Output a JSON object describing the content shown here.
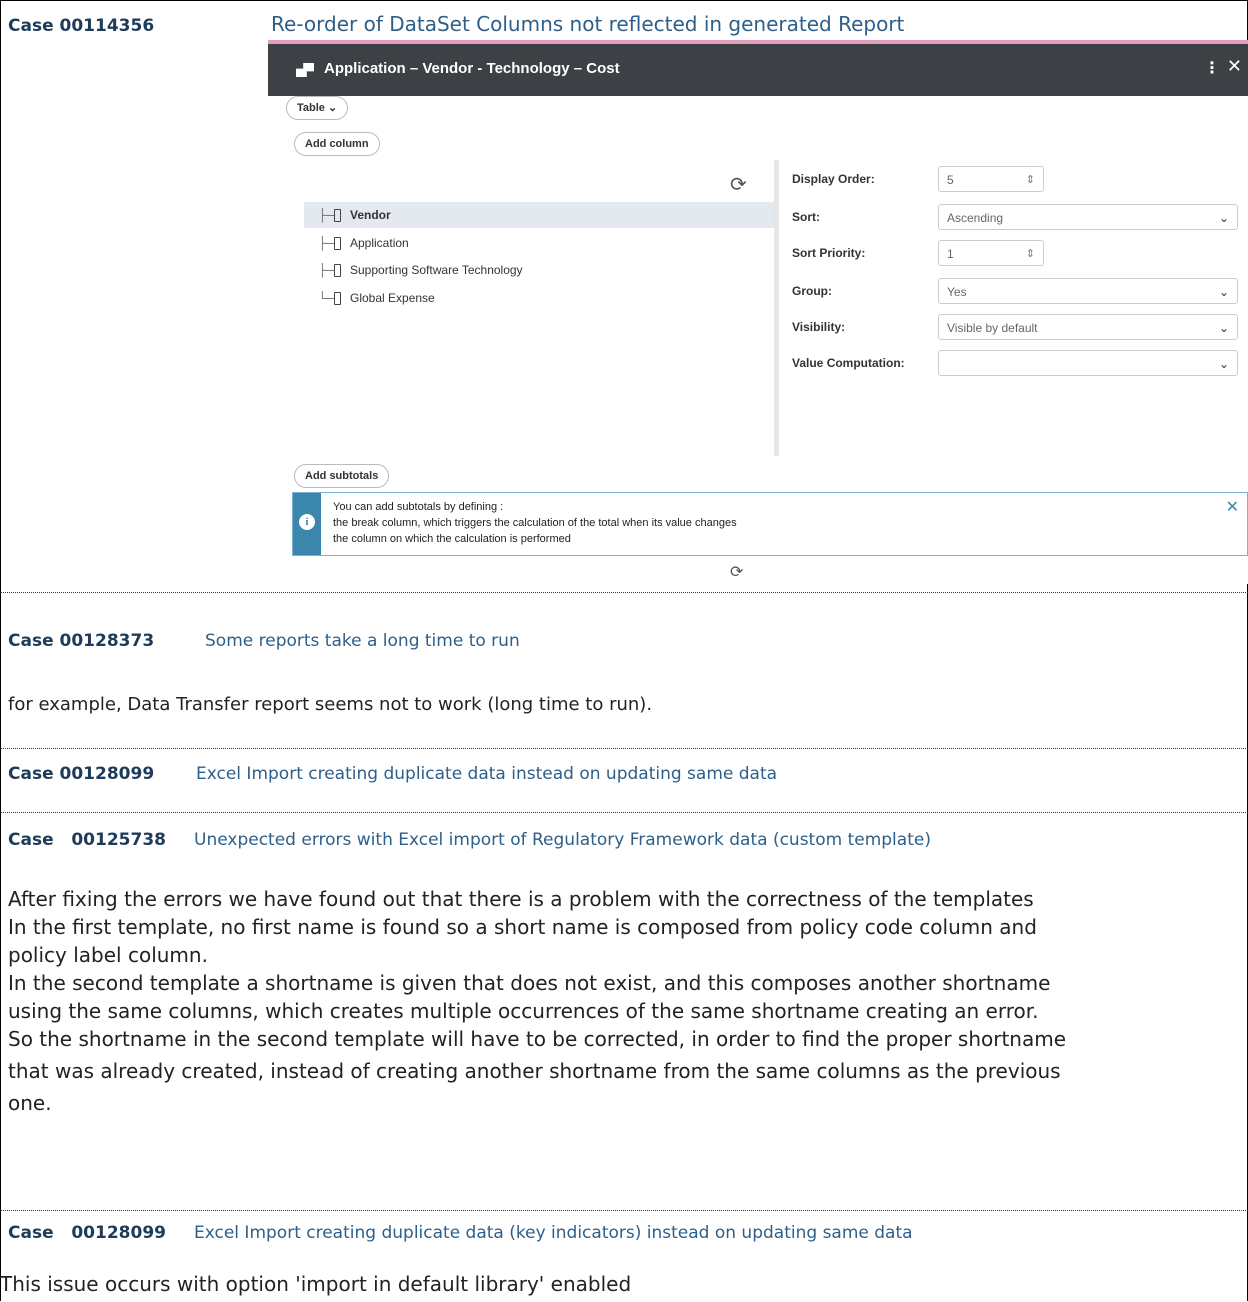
{
  "case1": {
    "id": "Case 00114356",
    "title": "Re-order of DataSet Columns not reflected in generated Report",
    "screenshot": {
      "window_title": "Application – Vendor - Technology – Cost",
      "menu_glyph": "⋮",
      "close_glyph": "✕",
      "view_dropdown": "Table",
      "add_column": "Add column",
      "add_subtotals": "Add subtotals",
      "tree_items": [
        "Vendor",
        "Application",
        "Supporting Software Technology",
        "Global Expense"
      ],
      "selected_item": "Vendor",
      "properties": {
        "display_order_label": "Display Order:",
        "display_order_value": "5",
        "sort_label": "Sort:",
        "sort_value": "Ascending",
        "sort_priority_label": "Sort Priority:",
        "sort_priority_value": "1",
        "group_label": "Group:",
        "group_value": "Yes",
        "visibility_label": "Visibility:",
        "visibility_value": "Visible by default",
        "value_computation_label": "Value Computation:",
        "value_computation_value": ""
      },
      "info": {
        "line1": "You can add subtotals by defining :",
        "line2": "the break column, which triggers the calculation of the total when its value changes",
        "line3": "the column on which the calculation is performed"
      },
      "colors": {
        "title_bar": "#3d4146",
        "info_accent": "#3a86ad",
        "selection": "#e4e8ef"
      }
    }
  },
  "case2": {
    "id": "Case 00128373",
    "title": "Some reports take a long time to run",
    "body": "for example, Data Transfer report seems not to work (long time to run)."
  },
  "case3": {
    "id": "Case 00128099",
    "title": "Excel Import creating duplicate data instead on updating same data"
  },
  "case4": {
    "id": "Case   00125738",
    "title": "Unexpected errors with Excel import of Regulatory Framework data (custom template)",
    "body_lines": [
      "After fixing the errors we have found out that there is a problem with the correctness of the templates",
      "In the first template, no first name is found so a short name is composed from policy code column and",
      "policy label column.",
      "In the second template a shortname is given that does not exist, and this composes another shortname",
      "using the same columns, which creates multiple occurrences of the same shortname creating an error.",
      "So the shortname in the second template will have to be corrected, in order to find the proper shortname",
      "that was already created, instead of creating another shortname from the same columns as the previous",
      "one."
    ]
  },
  "case5": {
    "id": "Case   00128099",
    "title": "Excel Import creating duplicate data (key indicators) instead on updating same data",
    "body": "This issue occurs with option 'import in default library' enabled"
  }
}
